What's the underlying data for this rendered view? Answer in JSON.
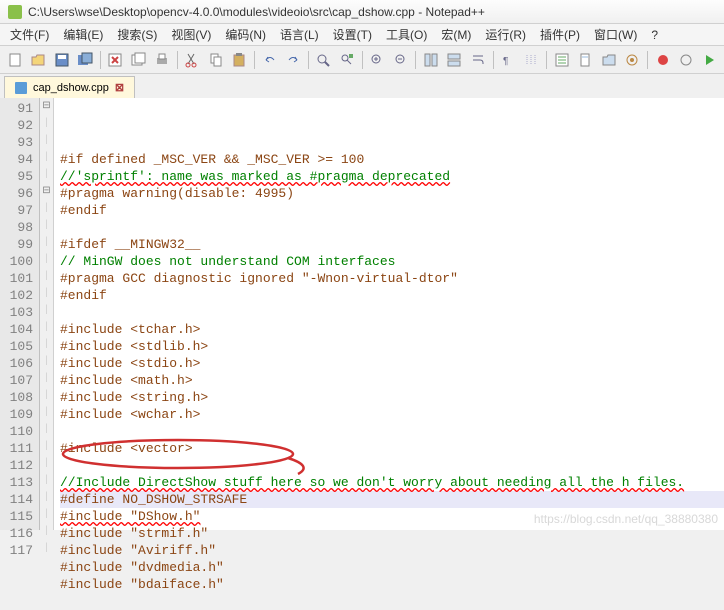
{
  "title": "C:\\Users\\wse\\Desktop\\opencv-4.0.0\\modules\\videoio\\src\\cap_dshow.cpp - Notepad++",
  "menu": {
    "file": "文件(F)",
    "edit": "编辑(E)",
    "search": "搜索(S)",
    "view": "视图(V)",
    "encoding": "编码(N)",
    "language": "语言(L)",
    "settings": "设置(T)",
    "tools": "工具(O)",
    "macro": "宏(M)",
    "run": "运行(R)",
    "plugins": "插件(P)",
    "window": "窗口(W)",
    "help": "?"
  },
  "tab": {
    "name": "cap_dshow.cpp"
  },
  "lines": [
    {
      "n": 91,
      "fold": "⊟",
      "cm": "",
      "txt": "#if defined _MSC_VER && _MSC_VER >= 100",
      "cls": "pp"
    },
    {
      "n": 92,
      "fold": "",
      "cm": "",
      "txt": "//'sprintf': name was marked as #pragma deprecated",
      "cls": "cm",
      "err": true
    },
    {
      "n": 93,
      "fold": "",
      "cm": "",
      "txt": "#pragma warning(disable: 4995)",
      "cls": "pp"
    },
    {
      "n": 94,
      "fold": "",
      "cm": "",
      "txt": "#endif",
      "cls": "pp"
    },
    {
      "n": 95,
      "fold": "",
      "cm": "",
      "txt": "",
      "cls": ""
    },
    {
      "n": 96,
      "fold": "⊟",
      "cm": "",
      "txt": "#ifdef __MINGW32__",
      "cls": "pp"
    },
    {
      "n": 97,
      "fold": "",
      "cm": "",
      "txt": "// MinGW does not understand COM interfaces",
      "cls": "cm"
    },
    {
      "n": 98,
      "fold": "",
      "cm": "",
      "txt": "#pragma GCC diagnostic ignored \"-Wnon-virtual-dtor\"",
      "cls": "pp"
    },
    {
      "n": 99,
      "fold": "",
      "cm": "",
      "txt": "#endif",
      "cls": "pp"
    },
    {
      "n": 100,
      "fold": "",
      "cm": "",
      "txt": "",
      "cls": ""
    },
    {
      "n": 101,
      "fold": "",
      "cm": "",
      "txt": "#include <tchar.h>",
      "cls": "pp"
    },
    {
      "n": 102,
      "fold": "",
      "cm": "",
      "txt": "#include <stdlib.h>",
      "cls": "pp"
    },
    {
      "n": 103,
      "fold": "",
      "cm": "",
      "txt": "#include <stdio.h>",
      "cls": "pp"
    },
    {
      "n": 104,
      "fold": "",
      "cm": "",
      "txt": "#include <math.h>",
      "cls": "pp"
    },
    {
      "n": 105,
      "fold": "",
      "cm": "",
      "txt": "#include <string.h>",
      "cls": "pp"
    },
    {
      "n": 106,
      "fold": "",
      "cm": "",
      "txt": "#include <wchar.h>",
      "cls": "pp"
    },
    {
      "n": 107,
      "fold": "",
      "cm": "",
      "txt": "",
      "cls": ""
    },
    {
      "n": 108,
      "fold": "",
      "cm": "",
      "txt": "#include <vector>",
      "cls": "pp"
    },
    {
      "n": 109,
      "fold": "",
      "cm": "",
      "txt": "",
      "cls": ""
    },
    {
      "n": 110,
      "fold": "",
      "cm": "",
      "txt": "//Include DirectShow stuff here so we don't worry about needing all the h files.",
      "cls": "cm",
      "err": true
    },
    {
      "n": 111,
      "fold": "",
      "cm": "",
      "txt": "#define NO_DSHOW_STRSAFE",
      "cls": "pp",
      "hl": true
    },
    {
      "n": 112,
      "fold": "",
      "cm": "",
      "txt": "#include \"DShow.h\"",
      "cls": "pp",
      "err": true
    },
    {
      "n": 113,
      "fold": "",
      "cm": "",
      "txt": "#include \"strmif.h\"",
      "cls": "pp"
    },
    {
      "n": 114,
      "fold": "",
      "cm": "",
      "txt": "#include \"Aviriff.h\"",
      "cls": "pp"
    },
    {
      "n": 115,
      "fold": "",
      "cm": "",
      "txt": "#include \"dvdmedia.h\"",
      "cls": "pp"
    },
    {
      "n": 116,
      "fold": "",
      "cm": "",
      "txt": "#include \"bdaiface.h\"",
      "cls": "pp"
    },
    {
      "n": 117,
      "fold": "",
      "cm": "",
      "txt": "",
      "cls": ""
    }
  ],
  "watermark": "https://blog.csdn.net/qq_38880380"
}
